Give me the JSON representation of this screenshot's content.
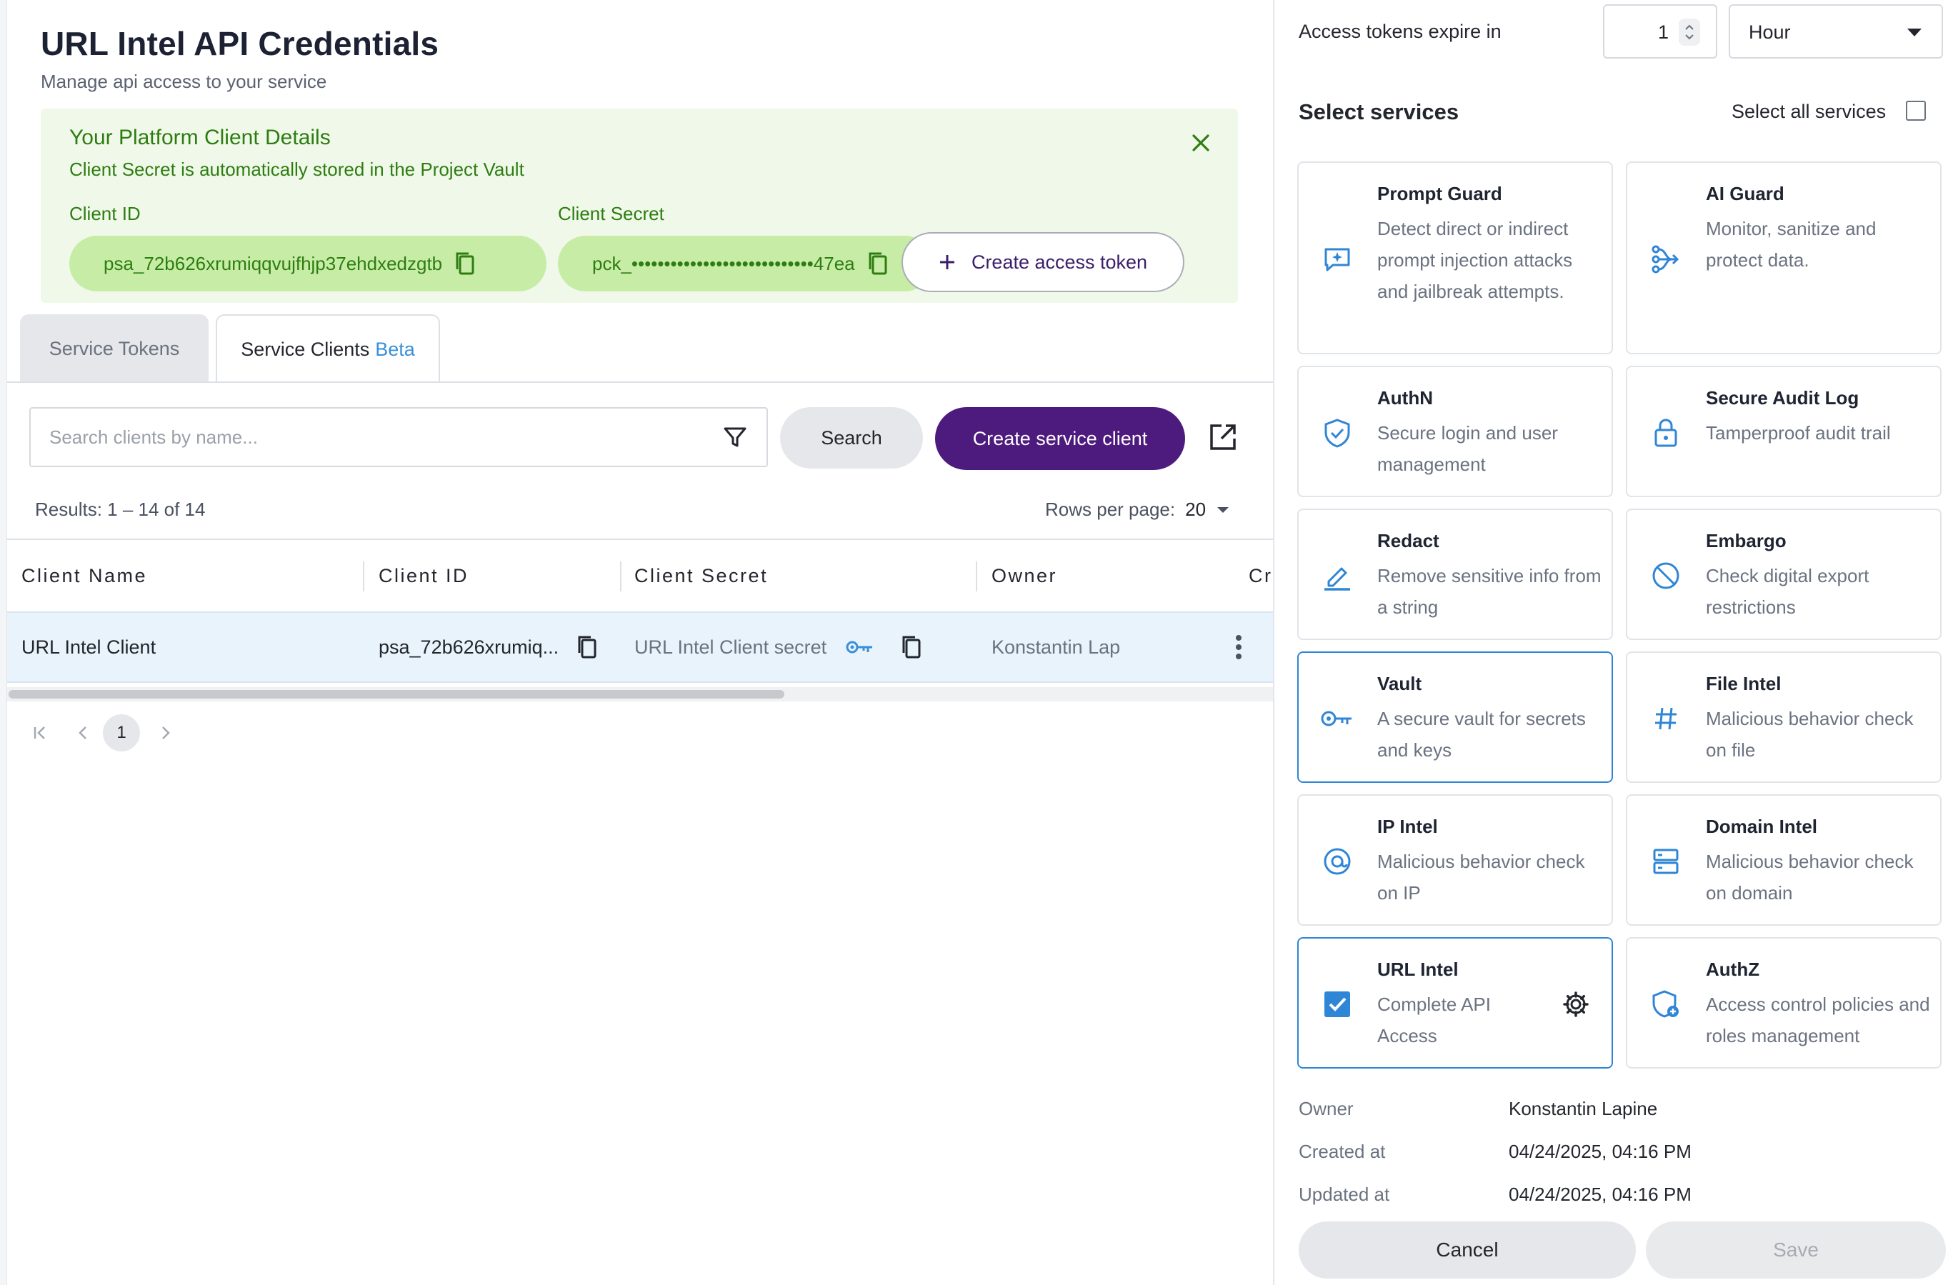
{
  "header": {
    "title": "URL Intel API Credentials",
    "subtitle": "Manage api access to your service"
  },
  "banner": {
    "title": "Your Platform Client Details",
    "note": "Client Secret is automatically stored in the Project Vault",
    "client_id_label": "Client ID",
    "client_id_value": "psa_72b626xrumiqqvujfhjp37ehdxedzgtb",
    "client_secret_label": "Client Secret",
    "client_secret_value": "pck_••••••••••••••••••••••••••••47ea",
    "create_token_label": "Create access token",
    "colors": {
      "background": "#f0f9e9",
      "pill": "#c7eca6",
      "text": "#2e7d12"
    }
  },
  "tabs": [
    {
      "label": "Service Tokens",
      "badge": "",
      "active": false
    },
    {
      "label": "Service Clients",
      "badge": "Beta",
      "active": true
    }
  ],
  "toolbar": {
    "search_placeholder": "Search clients by name...",
    "search_label": "Search",
    "create_label": "Create service client",
    "primary_color": "#4d1a7d"
  },
  "results": {
    "summary": "Results: 1 – 14 of 14",
    "rows_per_page_label": "Rows per page:",
    "rows_per_page_value": "20"
  },
  "table": {
    "columns": [
      "Client Name",
      "Client ID",
      "Client Secret",
      "Owner",
      "Cr"
    ],
    "rows": [
      {
        "client_name": "URL Intel Client",
        "client_id": "psa_72b626xrumiq...",
        "client_secret": "URL Intel Client secret",
        "owner": "Konstantin Lap"
      }
    ]
  },
  "pagination": {
    "current": "1"
  },
  "right_panel": {
    "expire_label": "Access tokens expire in",
    "expire_value": "1",
    "expire_unit": "Hour",
    "services_title": "Select services",
    "select_all_label": "Select all services",
    "select_all_checked": false,
    "services": [
      {
        "title": "Prompt Guard",
        "desc": "Detect direct or indirect prompt injection attacks and jailbreak attempts.",
        "icon": "prompt-guard-icon",
        "selected": false
      },
      {
        "title": "AI Guard",
        "desc": "Monitor, sanitize and protect data.",
        "icon": "ai-guard-icon",
        "selected": false
      },
      {
        "title": "AuthN",
        "desc": "Secure login and user management",
        "icon": "shield-check-icon",
        "selected": false
      },
      {
        "title": "Secure Audit Log",
        "desc": "Tamperproof audit trail",
        "icon": "lock-icon",
        "selected": false
      },
      {
        "title": "Redact",
        "desc": "Remove sensitive info from a string",
        "icon": "pen-icon",
        "selected": false
      },
      {
        "title": "Embargo",
        "desc": "Check digital export restrictions",
        "icon": "block-icon",
        "selected": false
      },
      {
        "title": "Vault",
        "desc": "A secure vault for secrets and keys",
        "icon": "key-icon",
        "selected": true
      },
      {
        "title": "File Intel",
        "desc": "Malicious behavior check on file",
        "icon": "hash-icon",
        "selected": false
      },
      {
        "title": "IP Intel",
        "desc": "Malicious behavior check on IP",
        "icon": "at-icon",
        "selected": false
      },
      {
        "title": "Domain Intel",
        "desc": "Malicious behavior check on domain",
        "icon": "server-icon",
        "selected": false
      },
      {
        "title": "URL Intel",
        "desc": "Complete API Access",
        "icon": "checkbox-checked-icon",
        "selected": true
      },
      {
        "title": "AuthZ",
        "desc": "Access control policies and roles management",
        "icon": "shield-plus-icon",
        "selected": false
      }
    ],
    "meta": [
      {
        "label": "Owner",
        "value": "Konstantin Lapine"
      },
      {
        "label": "Created at",
        "value": "04/24/2025, 04:16 PM"
      },
      {
        "label": "Updated at",
        "value": "04/24/2025, 04:16 PM"
      }
    ],
    "cancel_label": "Cancel",
    "save_label": "Save",
    "accent_color": "#2f86d6"
  }
}
